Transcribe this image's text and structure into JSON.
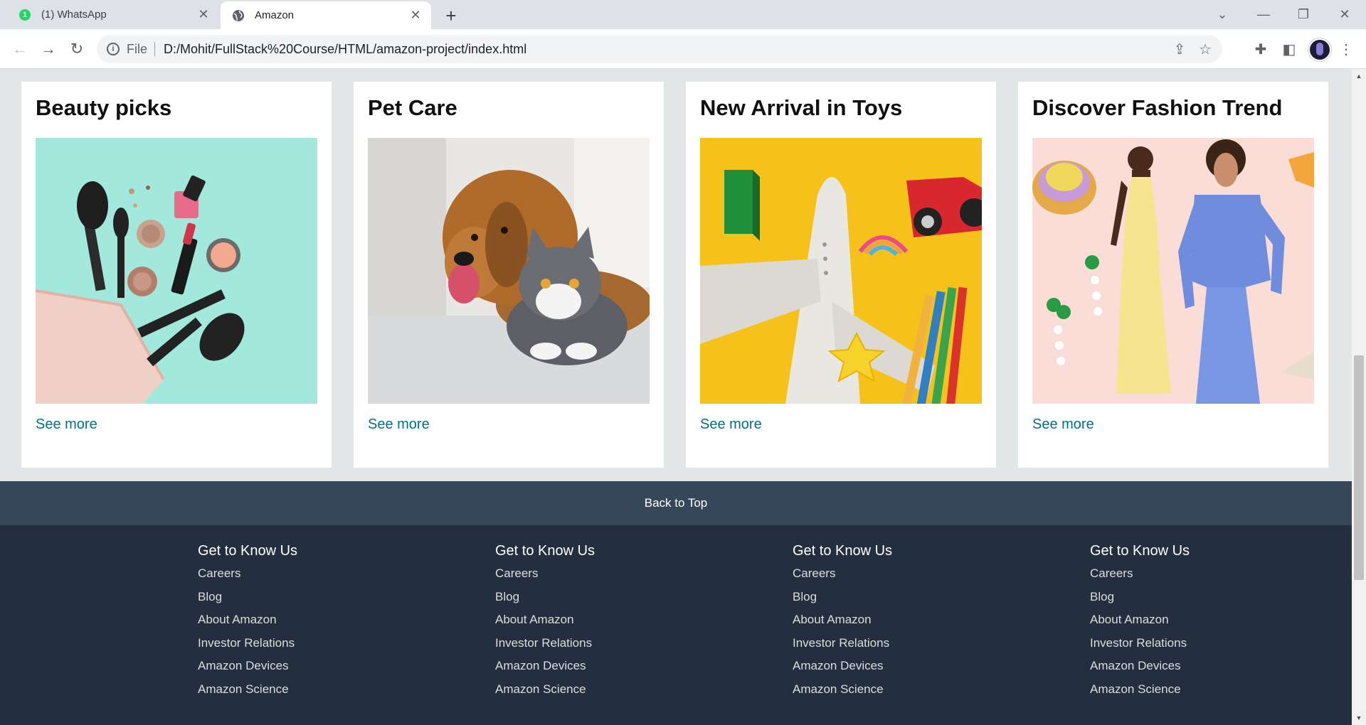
{
  "browser": {
    "tabs": [
      {
        "title": "(1) WhatsApp",
        "badge": "1"
      },
      {
        "title": "Amazon"
      }
    ],
    "address": {
      "scheme": "File",
      "url": "D:/Mohit/FullStack%20Course/HTML/amazon-project/index.html"
    }
  },
  "cards": [
    {
      "title": "Beauty picks",
      "link": "See more"
    },
    {
      "title": "Pet Care",
      "link": "See more"
    },
    {
      "title": "New Arrival in Toys",
      "link": "See more"
    },
    {
      "title": "Discover Fashion Trend",
      "link": "See more"
    }
  ],
  "back_to_top": "Back to Top",
  "footer": {
    "columns": [
      {
        "heading": "Get to Know Us",
        "links": [
          "Careers",
          "Blog",
          "About Amazon",
          "Investor Relations",
          "Amazon Devices",
          "Amazon Science"
        ]
      },
      {
        "heading": "Get to Know Us",
        "links": [
          "Careers",
          "Blog",
          "About Amazon",
          "Investor Relations",
          "Amazon Devices",
          "Amazon Science"
        ]
      },
      {
        "heading": "Get to Know Us",
        "links": [
          "Careers",
          "Blog",
          "About Amazon",
          "Investor Relations",
          "Amazon Devices",
          "Amazon Science"
        ]
      },
      {
        "heading": "Get to Know Us",
        "links": [
          "Careers",
          "Blog",
          "About Amazon",
          "Investor Relations",
          "Amazon Devices",
          "Amazon Science"
        ]
      }
    ]
  },
  "colors": {
    "link": "#007185",
    "back_to_top_bg": "#37475a",
    "footer_bg": "#232f3e",
    "page_bg": "#e3e6e6"
  }
}
